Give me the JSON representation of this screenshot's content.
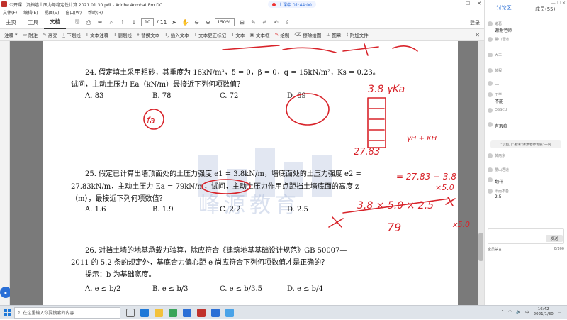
{
  "titlebar": {
    "title": "公开课：沉挡墙土压力与稳定性计算 2021.01.30.pdf - Adobe Acrobat Pro DC",
    "record_status": "上课中 01:44:00"
  },
  "menu": [
    "文件(F)",
    "编辑(E)",
    "视图(V)",
    "窗口(W)",
    "帮助(H)"
  ],
  "tabs": [
    "主页",
    "工具",
    "文档"
  ],
  "pager": {
    "current": "10",
    "total": "/ 11",
    "zoom": "150%"
  },
  "login_label": "登录",
  "toolbar": {
    "annotate": "注释",
    "items": [
      "附注",
      "高亮",
      "下划线",
      "文本注释",
      "删划线",
      "替换文本",
      "插入文本",
      "文本更正标记",
      "文本",
      "文本框",
      "绘制",
      "擦除绘图",
      "图章",
      "附加文件"
    ]
  },
  "questions": {
    "q24": {
      "line1": "24. 假定填土采用粗砂，其重度为 18kN/m³，δ = 0，β = 0，q = 15kN/m²，Ks = 0.23。",
      "line2": "试问，主动土压力 Ea（kN/m）最接近下列何项数值？",
      "options": [
        "A. 83",
        "B. 78",
        "C. 72",
        "D. 69"
      ]
    },
    "q25": {
      "line1": "25. 假定已计算出墙顶面处的土压力强度 e1 = 3.8kN/m，墙底面处的土压力强度 e2 =",
      "line2": "27.83kN/m，主动土压力 Ea = 79kN/m，试问，主动土压力作用点距挡土墙底面的高度 z",
      "line3": "（m），最接近下列何项数值？",
      "options": [
        "A. 1.6",
        "B. 1.9",
        "C. 2.2",
        "D. 2.5"
      ]
    },
    "q26": {
      "line1": "26. 对挡土墙的地基承载力验算，除应符合《建筑地基基础设计规范》GB 50007—",
      "line2": "2011 的 5.2 条的规定外，基底合力偏心距 e 尚应符合下列何项数值才是正确的？",
      "line3": "提示：b 为基础宽度。",
      "options": [
        "A. e ≤ b/2",
        "B. e ≤ b/3",
        "C. e ≤ b/3.5",
        "D. e ≤ b/4"
      ]
    }
  },
  "watermark": "峰源教育",
  "handwriting": {
    "top_right": "3.8 γKa",
    "value_27": "27.83",
    "kn": "γH + KH",
    "diff": "= 27.83 − 3.8",
    "x5": "×5.0",
    "formula": "3.8 × 5.0 × 2.5",
    "denominator": "79",
    "fa": "fa",
    "b1": "x5.0"
  },
  "chat": {
    "tab_discussion": "讨论区",
    "tab_members": "成员(55)",
    "messages": [
      {
        "name": "诸葛",
        "text": "谢谢老师"
      },
      {
        "name": "量山君道",
        "text": ""
      },
      {
        "name": "大工",
        "text": ""
      },
      {
        "name": "黄程",
        "text": ""
      },
      {
        "name": "",
        "text": "…"
      },
      {
        "name": "王学",
        "text": "不能"
      },
      {
        "name": "OSSCU",
        "text": ""
      },
      {
        "name": "",
        "text": "有瑕疵"
      }
    ],
    "notice": "\"小鱼儿\"邀请\"课源老师瑕疵\"一同",
    "messages2": [
      {
        "name": "黄两东",
        "text": ""
      },
      {
        "name": "量山君道",
        "text": ""
      },
      {
        "name": "",
        "text": "翻样"
      },
      {
        "name": "讯而不备",
        "text": "2.5"
      }
    ],
    "send_label": "发送",
    "bottom_left": "全员禁言",
    "bottom_right": "0/300"
  },
  "taskbar": {
    "search_placeholder": "在这里输入你要搜索的内容",
    "time": "16:42",
    "date": "2021/1/30",
    "lang": "中"
  }
}
